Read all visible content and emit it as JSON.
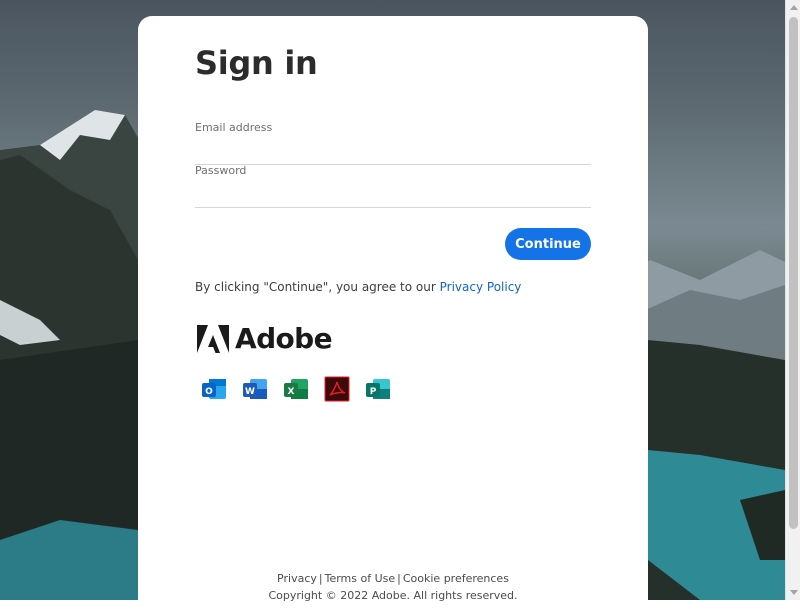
{
  "signin": {
    "title": "Sign in",
    "email_label": "Email address",
    "email_value": "",
    "password_label": "Password",
    "password_value": "",
    "continue_label": "Continue",
    "agree_text": "By clicking \"Continue\", you agree to our",
    "privacy_policy_link": "Privacy Policy"
  },
  "brand": {
    "wordmark": "Adobe",
    "logo_icon": "adobe-a-icon",
    "accent_color": "#1473e6"
  },
  "apps": [
    {
      "name": "outlook-icon",
      "letter": "O",
      "color": "#0a64c8"
    },
    {
      "name": "word-icon",
      "letter": "W",
      "color": "#1d5bb5"
    },
    {
      "name": "excel-icon",
      "letter": "X",
      "color": "#1a7a44"
    },
    {
      "name": "acrobat-icon",
      "letter": "",
      "color": "#3c0a0a"
    },
    {
      "name": "publisher-icon",
      "letter": "P",
      "color": "#0f7f7c"
    }
  ],
  "footer": {
    "privacy": "Privacy",
    "terms": "Terms of Use",
    "cookies": "Cookie preferences",
    "separator": "|",
    "copyright": "Copyright © 2022 Adobe. All rights reserved."
  }
}
